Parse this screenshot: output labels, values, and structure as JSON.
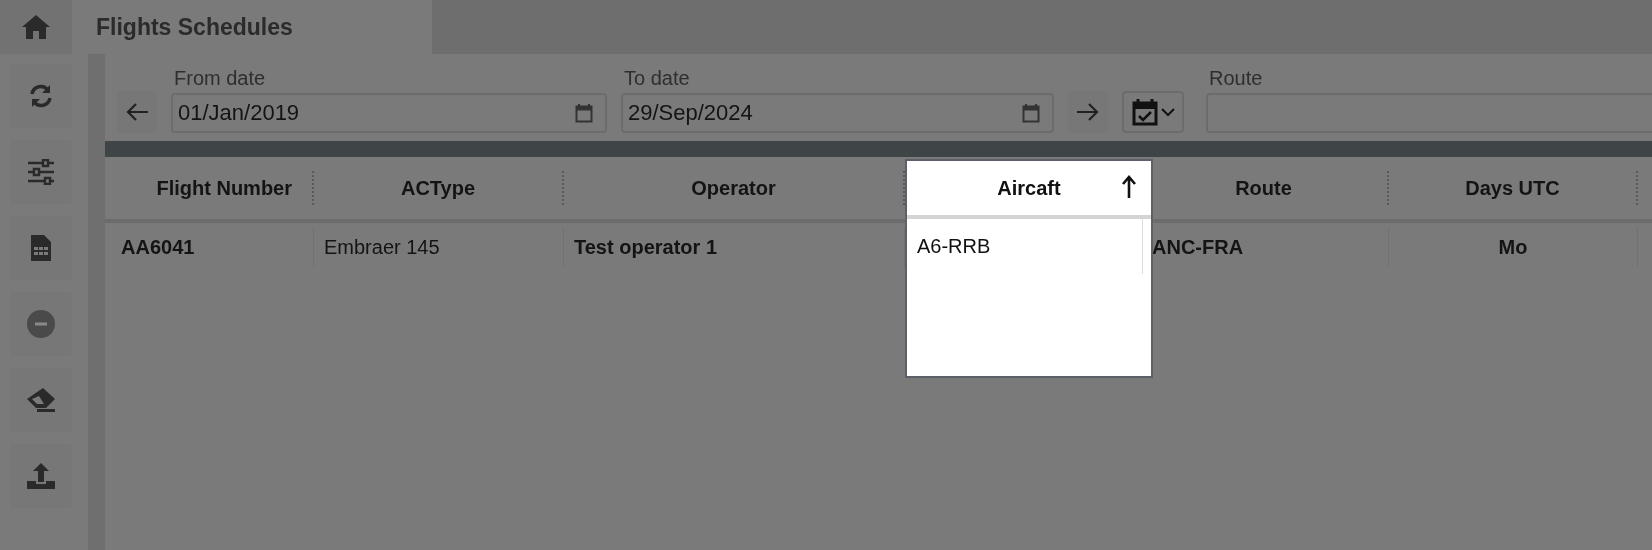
{
  "title": "Flights Schedules",
  "filters": {
    "from_date": {
      "label": "From date",
      "value": "01/Jan/2019"
    },
    "to_date": {
      "label": "To date",
      "value": "29/Sep/2024"
    },
    "route": {
      "label": "Route"
    }
  },
  "table": {
    "columns": [
      {
        "label": "Flight Number",
        "bold": true,
        "dragging": false,
        "sorted": false
      },
      {
        "label": "ACType",
        "bold": false,
        "dragging": false,
        "sorted": false
      },
      {
        "label": "Operator",
        "bold": true,
        "dragging": false,
        "sorted": false
      },
      {
        "label": "Aircaft",
        "bold": false,
        "dragging": true,
        "sorted": true
      },
      {
        "label": "Route",
        "bold": true,
        "dragging": false,
        "sorted": false
      },
      {
        "label": "Days UTC",
        "bold": true,
        "dragging": false,
        "sorted": false
      }
    ],
    "rows": [
      [
        "AA6041",
        "Embraer 145",
        "Test operator 1",
        "A6-RRB",
        "ANC-FRA",
        "Mo"
      ]
    ]
  }
}
